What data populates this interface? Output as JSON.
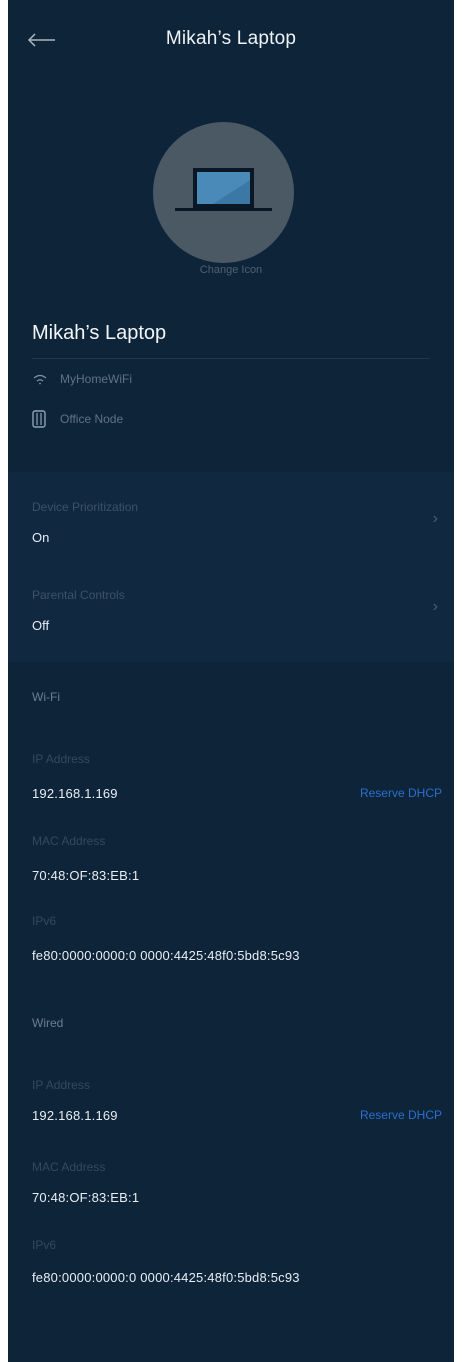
{
  "header": {
    "title": "Mikah’s Laptop"
  },
  "device": {
    "change_icon_label": "Change Icon",
    "name": "Mikah’s Laptop",
    "network": "MyHomeWiFi",
    "node": "Office Node"
  },
  "settings": [
    {
      "label": "Device Prioritization",
      "value": "On"
    },
    {
      "label": "Parental Controls",
      "value": "Off"
    }
  ],
  "wifi": {
    "title": "Wi-Fi",
    "ip_label": "IP Address",
    "ip": "192.168.1.169",
    "reserve_label": "Reserve DHCP",
    "mac_label": "MAC Address",
    "mac": "70:48:OF:83:EB:1",
    "ipv6_label": "IPv6",
    "ipv6": "fe80:0000:0000:0 0000:4425:48f0:5bd8:5c93"
  },
  "wired": {
    "title": "Wired",
    "ip_label": "IP Address",
    "ip": "192.168.1.169",
    "reserve_label": "Reserve DHCP",
    "mac_label": "MAC Address",
    "mac": "70:48:OF:83:EB:1",
    "ipv6_label": "IPv6",
    "ipv6": "fe80:0000:0000:0 0000:4425:48f0:5bd8:5c93"
  },
  "colors": {
    "background": "#0e2439",
    "section": "#102840",
    "link": "#2b6fd1",
    "avatar": "#4b5965"
  }
}
